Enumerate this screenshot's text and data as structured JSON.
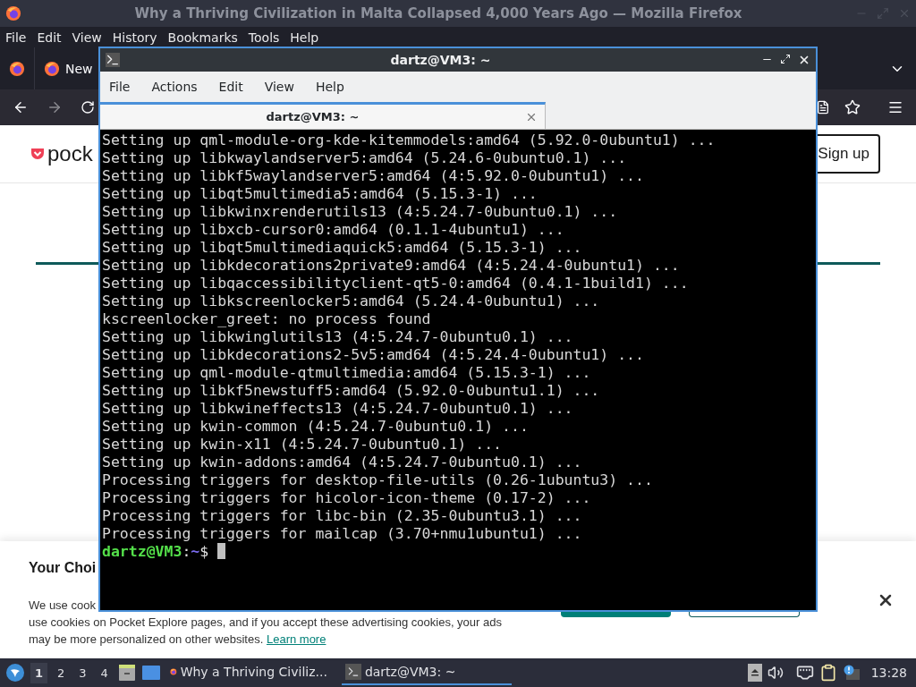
{
  "browser": {
    "title": "Why a Thriving Civilization in Malta Collapsed 4,000 Years Ago — Mozilla Firefox",
    "menu": [
      "File",
      "Edit",
      "View",
      "History",
      "Bookmarks",
      "Tools",
      "Help"
    ],
    "tabs": [
      {
        "label": "New",
        "selected": false
      }
    ],
    "page": {
      "logo": "pock",
      "signup": "Sign up",
      "cookie_banner": {
        "title": "Your Choi",
        "lines": [
          "We use cook",
          "use cookies on Pocket Explore pages, and if you accept these advertising cookies, your ads",
          "may be more personalized on other websites."
        ],
        "link": "Learn more"
      }
    }
  },
  "terminal": {
    "title": "dartz@VM3: ~",
    "menu": [
      "File",
      "Actions",
      "Edit",
      "View",
      "Help"
    ],
    "tabs": [
      {
        "label": "dartz@VM3: ~",
        "selected": true
      }
    ],
    "lines": [
      "Setting up qml-module-org-kde-kitemmodels:amd64 (5.92.0-0ubuntu1) ...",
      "Setting up libkwaylandserver5:amd64 (5.24.6-0ubuntu0.1) ...",
      "Setting up libkf5waylandserver5:amd64 (4:5.92.0-0ubuntu1) ...",
      "Setting up libqt5multimedia5:amd64 (5.15.3-1) ...",
      "Setting up libkwinxrenderutils13 (4:5.24.7-0ubuntu0.1) ...",
      "Setting up libxcb-cursor0:amd64 (0.1.1-4ubuntu1) ...",
      "Setting up libqt5multimediaquick5:amd64 (5.15.3-1) ...",
      "Setting up libkdecorations2private9:amd64 (4:5.24.4-0ubuntu1) ...",
      "Setting up libqaccessibilityclient-qt5-0:amd64 (0.4.1-1build1) ...",
      "Setting up libkscreenlocker5:amd64 (5.24.4-0ubuntu1) ...",
      "kscreenlocker_greet: no process found",
      "Setting up libkwinglutils13 (4:5.24.7-0ubuntu0.1) ...",
      "Setting up libkdecorations2-5v5:amd64 (4:5.24.4-0ubuntu1) ...",
      "Setting up qml-module-qtmultimedia:amd64 (5.15.3-1) ...",
      "Setting up libkf5newstuff5:amd64 (5.92.0-0ubuntu1.1) ...",
      "Setting up libkwineffects13 (4:5.24.7-0ubuntu0.1) ...",
      "Setting up kwin-common (4:5.24.7-0ubuntu0.1) ...",
      "Setting up kwin-x11 (4:5.24.7-0ubuntu0.1) ...",
      "Setting up kwin-addons:amd64 (4:5.24.7-0ubuntu0.1) ...",
      "Processing triggers for desktop-file-utils (0.26-1ubuntu3) ...",
      "Processing triggers for hicolor-icon-theme (0.17-2) ...",
      "Processing triggers for libc-bin (2.35-0ubuntu3.1) ...",
      "Processing triggers for mailcap (3.70+nmu1ubuntu1) ..."
    ],
    "prompt": {
      "user": "dartz@VM3",
      "separator": ":",
      "path": "~",
      "symbol": "$"
    }
  },
  "taskbar": {
    "workspaces": [
      {
        "label": "1",
        "selected": true
      },
      {
        "label": "2",
        "selected": false
      },
      {
        "label": "3",
        "selected": false
      },
      {
        "label": "4",
        "selected": false
      }
    ],
    "tasks": [
      {
        "kind": "browser",
        "label": "Why a Thriving Civiliz...",
        "selected": false
      },
      {
        "kind": "terminal",
        "label": "dartz@VM3: ~",
        "selected": true
      }
    ],
    "clock": "13:28"
  }
}
